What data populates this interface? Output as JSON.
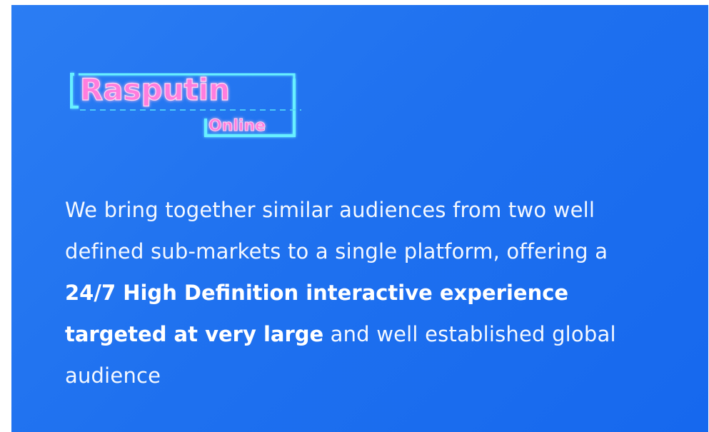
{
  "logo": {
    "word1": "Rasputin",
    "word2": "Online"
  },
  "description": {
    "text_start": "We bring together similar audiences from two well defined sub-markets to a single platform, offering a ",
    "text_bold": "24/7 High Definition interactive experience targeted at very large",
    "text_end": " and well established global audience"
  },
  "colors": {
    "background": "#1f71ef",
    "text": "#f4f8ff",
    "logo_pink": "#ff5fd2",
    "logo_cyan": "#59f1ff"
  }
}
